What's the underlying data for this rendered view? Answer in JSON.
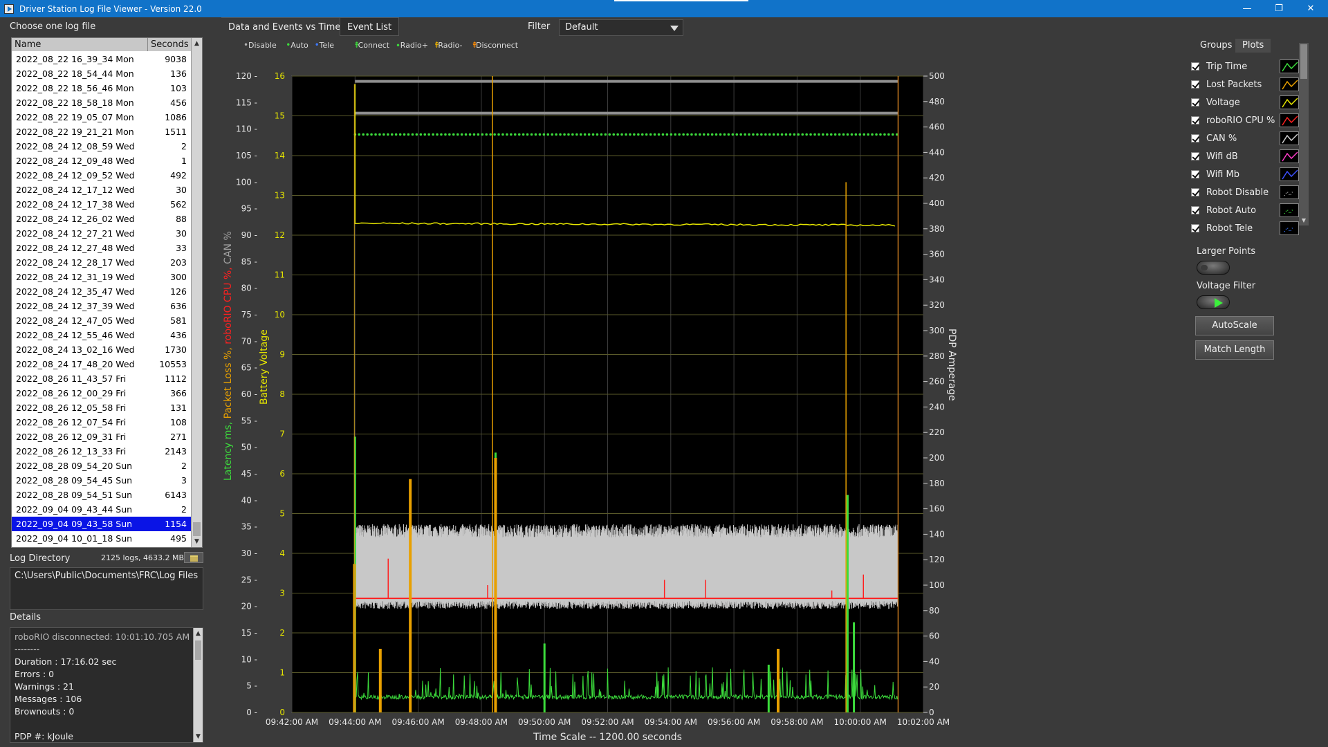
{
  "window": {
    "title": "Driver Station Log File Viewer - Version 22.0",
    "minimize": "—",
    "restore": "❐",
    "close": "✕"
  },
  "left": {
    "choose_label": "Choose one log file",
    "col_name": "Name",
    "col_seconds": "Seconds",
    "logs": [
      {
        "name": "2022_08_22 16_39_34 Mon",
        "seconds": "9038"
      },
      {
        "name": "2022_08_22 18_54_44 Mon",
        "seconds": "136"
      },
      {
        "name": "2022_08_22 18_56_46 Mon",
        "seconds": "103"
      },
      {
        "name": "2022_08_22 18_58_18 Mon",
        "seconds": "456"
      },
      {
        "name": "2022_08_22 19_05_07 Mon",
        "seconds": "1086"
      },
      {
        "name": "2022_08_22 19_21_21 Mon",
        "seconds": "1511"
      },
      {
        "name": "2022_08_24 12_08_59 Wed",
        "seconds": "2"
      },
      {
        "name": "2022_08_24 12_09_48 Wed",
        "seconds": "1"
      },
      {
        "name": "2022_08_24 12_09_52 Wed",
        "seconds": "492"
      },
      {
        "name": "2022_08_24 12_17_12 Wed",
        "seconds": "30"
      },
      {
        "name": "2022_08_24 12_17_38 Wed",
        "seconds": "562"
      },
      {
        "name": "2022_08_24 12_26_02 Wed",
        "seconds": "88"
      },
      {
        "name": "2022_08_24 12_27_21 Wed",
        "seconds": "30"
      },
      {
        "name": "2022_08_24 12_27_48 Wed",
        "seconds": "33"
      },
      {
        "name": "2022_08_24 12_28_17 Wed",
        "seconds": "203"
      },
      {
        "name": "2022_08_24 12_31_19 Wed",
        "seconds": "300"
      },
      {
        "name": "2022_08_24 12_35_47 Wed",
        "seconds": "126"
      },
      {
        "name": "2022_08_24 12_37_39 Wed",
        "seconds": "636"
      },
      {
        "name": "2022_08_24 12_47_05 Wed",
        "seconds": "581"
      },
      {
        "name": "2022_08_24 12_55_46 Wed",
        "seconds": "436"
      },
      {
        "name": "2022_08_24 13_02_16 Wed",
        "seconds": "1730"
      },
      {
        "name": "2022_08_24 17_48_20 Wed",
        "seconds": "10553"
      },
      {
        "name": "2022_08_26 11_43_57 Fri",
        "seconds": "1112"
      },
      {
        "name": "2022_08_26 12_00_29 Fri",
        "seconds": "366"
      },
      {
        "name": "2022_08_26 12_05_58 Fri",
        "seconds": "131"
      },
      {
        "name": "2022_08_26 12_07_54 Fri",
        "seconds": "108"
      },
      {
        "name": "2022_08_26 12_09_31 Fri",
        "seconds": "271"
      },
      {
        "name": "2022_08_26 12_13_33 Fri",
        "seconds": "2143"
      },
      {
        "name": "2022_08_28 09_54_20 Sun",
        "seconds": "2"
      },
      {
        "name": "2022_08_28 09_54_45 Sun",
        "seconds": "3"
      },
      {
        "name": "2022_08_28 09_54_51 Sun",
        "seconds": "6143"
      },
      {
        "name": "2022_09_04 09_43_44 Sun",
        "seconds": "2"
      },
      {
        "name": "2022_09_04 09_43_58 Sun",
        "seconds": "1154",
        "selected": true
      },
      {
        "name": "2022_09_04 10_01_18 Sun",
        "seconds": "495"
      }
    ],
    "log_dir_label": "Log Directory",
    "log_stats": "2125 logs, 4633.2 MB",
    "log_dir_path": "C:\\Users\\Public\\Documents\\FRC\\Log Files",
    "details_label": "Details",
    "details_lines": [
      "roboRIO disconnected:  10:01:10.705 AM",
      "--------",
      "Duration : 17:16.02 sec",
      "Errors : 0",
      "Warnings : 21",
      "Messages : 106",
      "Brownouts : 0",
      "",
      "PDP #:   kJoule"
    ]
  },
  "center": {
    "tab_active": "Data and Events vs Time",
    "tab_inactive": "Event List",
    "filter_label": "Filter",
    "filter_value": "Default",
    "legend": [
      {
        "label": "Disable",
        "color": "#b0b0b0",
        "glyph": "•"
      },
      {
        "label": "Auto",
        "color": "#3cdc3c",
        "glyph": "•"
      },
      {
        "label": "Tele",
        "color": "#3c78ff",
        "glyph": "•"
      },
      {
        "label": "Connect",
        "color": "#3cdc3c",
        "glyph": "⇞"
      },
      {
        "label": "Radio+",
        "color": "#3cdc3c",
        "glyph": "∙"
      },
      {
        "label": "Radio-",
        "color": "#e8b000",
        "glyph": "⇞"
      },
      {
        "label": "Disconnect",
        "color": "#ff8a00",
        "glyph": "⇞"
      }
    ]
  },
  "chart_data": {
    "type": "line",
    "title": "",
    "xlabel": "Time Scale -- 1200.00 seconds",
    "x_ticks": [
      "09:42:00 AM",
      "09:44:00 AM",
      "09:46:00 AM",
      "09:48:00 AM",
      "09:50:00 AM",
      "09:52:00 AM",
      "09:54:00 AM",
      "09:56:00 AM",
      "09:58:00 AM",
      "10:00:00 AM",
      "10:02:00 AM"
    ],
    "xlim_minutes": [
      0,
      20
    ],
    "left_axis_label_parts": [
      {
        "text": "Latency ms,",
        "color": "#3cdc3c"
      },
      {
        "text": "Packet Loss %,",
        "color": "#e8a000"
      },
      {
        "text": "roboRIO CPU %,",
        "color": "#ff2020"
      },
      {
        "text": "CAN %",
        "color": "#a0a0a0"
      }
    ],
    "ylabel_voltage": "Battery Voltage",
    "ylabel_right": "PDP Amperage",
    "y_pct_ticks": [
      "0",
      "5",
      "10",
      "15",
      "20",
      "25",
      "30",
      "35",
      "40",
      "45",
      "50",
      "55",
      "60",
      "65",
      "70",
      "75",
      "80",
      "85",
      "90",
      "95",
      "100",
      "105",
      "110",
      "115",
      "120"
    ],
    "ylim_pct": [
      0,
      120
    ],
    "y_volt_ticks": [
      "0",
      "1",
      "2",
      "3",
      "4",
      "5",
      "6",
      "7",
      "8",
      "9",
      "10",
      "11",
      "12",
      "13",
      "14",
      "15",
      "16"
    ],
    "ylim_volt": [
      0,
      16
    ],
    "y_amp_ticks": [
      "0",
      "20",
      "40",
      "60",
      "80",
      "100",
      "120",
      "140",
      "160",
      "180",
      "200",
      "220",
      "240",
      "260",
      "280",
      "300",
      "320",
      "340",
      "360",
      "380",
      "400",
      "420",
      "440",
      "460",
      "480",
      "500"
    ],
    "ylim_amp": [
      0,
      500
    ],
    "log_start_min": 2.0,
    "log_end_min": 19.2,
    "series": {
      "voltage_volts": 12.3,
      "can_pct_range": [
        21,
        33
      ],
      "cpu_pct_baseline": 21.5,
      "cpu_spikes": [
        {
          "t": 3.05,
          "pct": 29
        },
        {
          "t": 6.2,
          "pct": 24
        },
        {
          "t": 11.8,
          "pct": 25
        },
        {
          "t": 13.1,
          "pct": 25
        },
        {
          "t": 17.1,
          "pct": 23
        },
        {
          "t": 18.1,
          "pct": 26
        }
      ],
      "latency_ms_baseline": 2.5,
      "latency_spikes": [
        {
          "t": 2.0,
          "ms": 52
        },
        {
          "t": 6.45,
          "ms": 49
        },
        {
          "t": 17.6,
          "ms": 41
        },
        {
          "t": 17.8,
          "ms": 17
        },
        {
          "t": 8.0,
          "ms": 13
        },
        {
          "t": 15.1,
          "ms": 9
        }
      ],
      "packet_loss_spikes": [
        {
          "t": 1.98,
          "pct": 28
        },
        {
          "t": 2.8,
          "pct": 12
        },
        {
          "t": 3.75,
          "pct": 44
        },
        {
          "t": 6.45,
          "pct": 48
        },
        {
          "t": 6.35,
          "pct": 120
        },
        {
          "t": 17.55,
          "pct": 100
        },
        {
          "t": 15.4,
          "pct": 12
        }
      ],
      "disable_bars_pct": [
        119,
        113
      ],
      "auto_dots_pct": 109
    }
  },
  "right": {
    "tab_groups": "Groups",
    "tab_plots": "Plots",
    "plots": [
      {
        "label": "Trip Time",
        "color": "#3cdc3c"
      },
      {
        "label": "Lost Packets",
        "color": "#e8a000"
      },
      {
        "label": "Voltage",
        "color": "#e6e600"
      },
      {
        "label": "roboRIO CPU %",
        "color": "#ff2020"
      },
      {
        "label": "CAN %",
        "color": "#d0d0d0"
      },
      {
        "label": "Wifi dB",
        "color": "#ff3cc8"
      },
      {
        "label": "Wifi Mb",
        "color": "#3c50ff"
      },
      {
        "label": "Robot Disable",
        "color": "#b0b0b0"
      },
      {
        "label": "Robot Auto",
        "color": "#3cdc3c"
      },
      {
        "label": "Robot Tele",
        "color": "#3c78ff"
      }
    ],
    "larger_points_label": "Larger Points",
    "voltage_filter_label": "Voltage Filter",
    "autoscale_label": "AutoScale",
    "match_length_label": "Match Length"
  }
}
